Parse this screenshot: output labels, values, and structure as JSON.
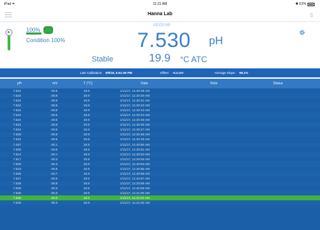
{
  "status_bar": {
    "carrier": "iPad ≑",
    "time": "11:21 AM",
    "battery": "✱ 61%"
  },
  "nav": {
    "title": "Hanna Lab"
  },
  "probe": {
    "percent": "100%",
    "condition": "Condition 100%",
    "percent_value": 1.0
  },
  "measurement": {
    "serial": "A9:D0:65",
    "value": "7.530",
    "unit": "pH",
    "stability": "Stable",
    "temperature": "19.9",
    "temperature_unit": "°C ATC"
  },
  "calibration": {
    "last_cal_label": "Last Calibration:",
    "last_cal_value": "9/9/16, 6:51:06 PM",
    "offset_label": "Offset:",
    "offset_value": "-0.4 mV",
    "slope_label": "Average Slope:",
    "slope_value": "96.1%"
  },
  "table": {
    "headers": {
      "ph": "pH",
      "mv": "mV",
      "t": "T (°C)",
      "date": "Date",
      "note": "Note",
      "status": "Status"
    },
    "rows": [
      {
        "ph": "7.524",
        "mv": "-29.6",
        "t": "19.9",
        "date": "1/11/17, 11:20:39 AM"
      },
      {
        "ph": "7.524",
        "mv": "-29.6",
        "t": "19.9",
        "date": "1/11/17, 11:20:40 AM"
      },
      {
        "ph": "7.524",
        "mv": "-29.6",
        "t": "19.9",
        "date": "1/11/17, 11:20:41 AM"
      },
      {
        "ph": "7.524",
        "mv": "-29.6",
        "t": "19.9",
        "date": "1/11/17, 11:20:42 AM"
      },
      {
        "ph": "7.524",
        "mv": "-29.6",
        "t": "19.9",
        "date": "1/11/17, 11:20:43 AM"
      },
      {
        "ph": "7.524",
        "mv": "-29.6",
        "t": "19.9",
        "date": "1/11/17, 11:20:44 AM"
      },
      {
        "ph": "7.524",
        "mv": "-29.6",
        "t": "19.9",
        "date": "1/11/17, 11:20:45 AM"
      },
      {
        "ph": "7.524",
        "mv": "-29.6",
        "t": "19.9",
        "date": "1/11/17, 11:20:46 AM"
      },
      {
        "ph": "7.524",
        "mv": "-29.6",
        "t": "19.9",
        "date": "1/11/17, 11:20:47 AM"
      },
      {
        "ph": "7.526",
        "mv": "-29.8",
        "t": "19.9",
        "date": "1/11/17, 11:20:48 AM"
      },
      {
        "ph": "7.524",
        "mv": "-29.6",
        "t": "19.9",
        "date": "1/11/17, 11:20:49 AM"
      },
      {
        "ph": "7.497",
        "mv": "-28.1",
        "t": "19.9",
        "date": "1/11/17, 11:20:50 AM"
      },
      {
        "ph": "7.506",
        "mv": "-28.6",
        "t": "19.9",
        "date": "1/11/17, 11:20:51 AM"
      },
      {
        "ph": "7.514",
        "mv": "-29.1",
        "t": "19.9",
        "date": "1/11/17, 11:20:52 AM"
      },
      {
        "ph": "7.517",
        "mv": "-29.3",
        "t": "19.9",
        "date": "1/11/17, 11:20:53 AM"
      },
      {
        "ph": "7.520",
        "mv": "-29.4",
        "t": "19.9",
        "date": "1/11/17, 11:20:54 AM"
      },
      {
        "ph": "7.523",
        "mv": "-29.6",
        "t": "19.9",
        "date": "1/11/17, 11:20:55 AM"
      },
      {
        "ph": "7.525",
        "mv": "-29.7",
        "t": "19.9",
        "date": "1/11/17, 11:20:56 AM"
      },
      {
        "ph": "7.527",
        "mv": "-29.8",
        "t": "19.9",
        "date": "1/11/17, 11:20:57 AM"
      },
      {
        "ph": "7.528",
        "mv": "-29.9",
        "t": "19.9",
        "date": "1/11/17, 11:20:58 AM"
      },
      {
        "ph": "7.529",
        "mv": "-30.0",
        "t": "19.9",
        "date": "1/11/17, 11:20:59 AM"
      },
      {
        "ph": "7.530",
        "mv": "-30.0",
        "t": "19.9",
        "date": "1/11/17, 11:21:00 AM"
      },
      {
        "ph": "7.530",
        "mv": "-30.0",
        "t": "19.9",
        "date": "1/11/17, 11:21:01 AM",
        "selected": true
      },
      {
        "ph": "7.530",
        "mv": "-30.0",
        "t": "19.9",
        "date": "1/11/17, 11:21:02 AM"
      }
    ]
  },
  "colors": {
    "accent": "#3a7fc1",
    "cal_bar": "#1f64ba",
    "table_bg": "#1b5fa8",
    "table_header": "#3379c4",
    "selected_row": "#44b23f",
    "probe_green": "#41b84a"
  }
}
